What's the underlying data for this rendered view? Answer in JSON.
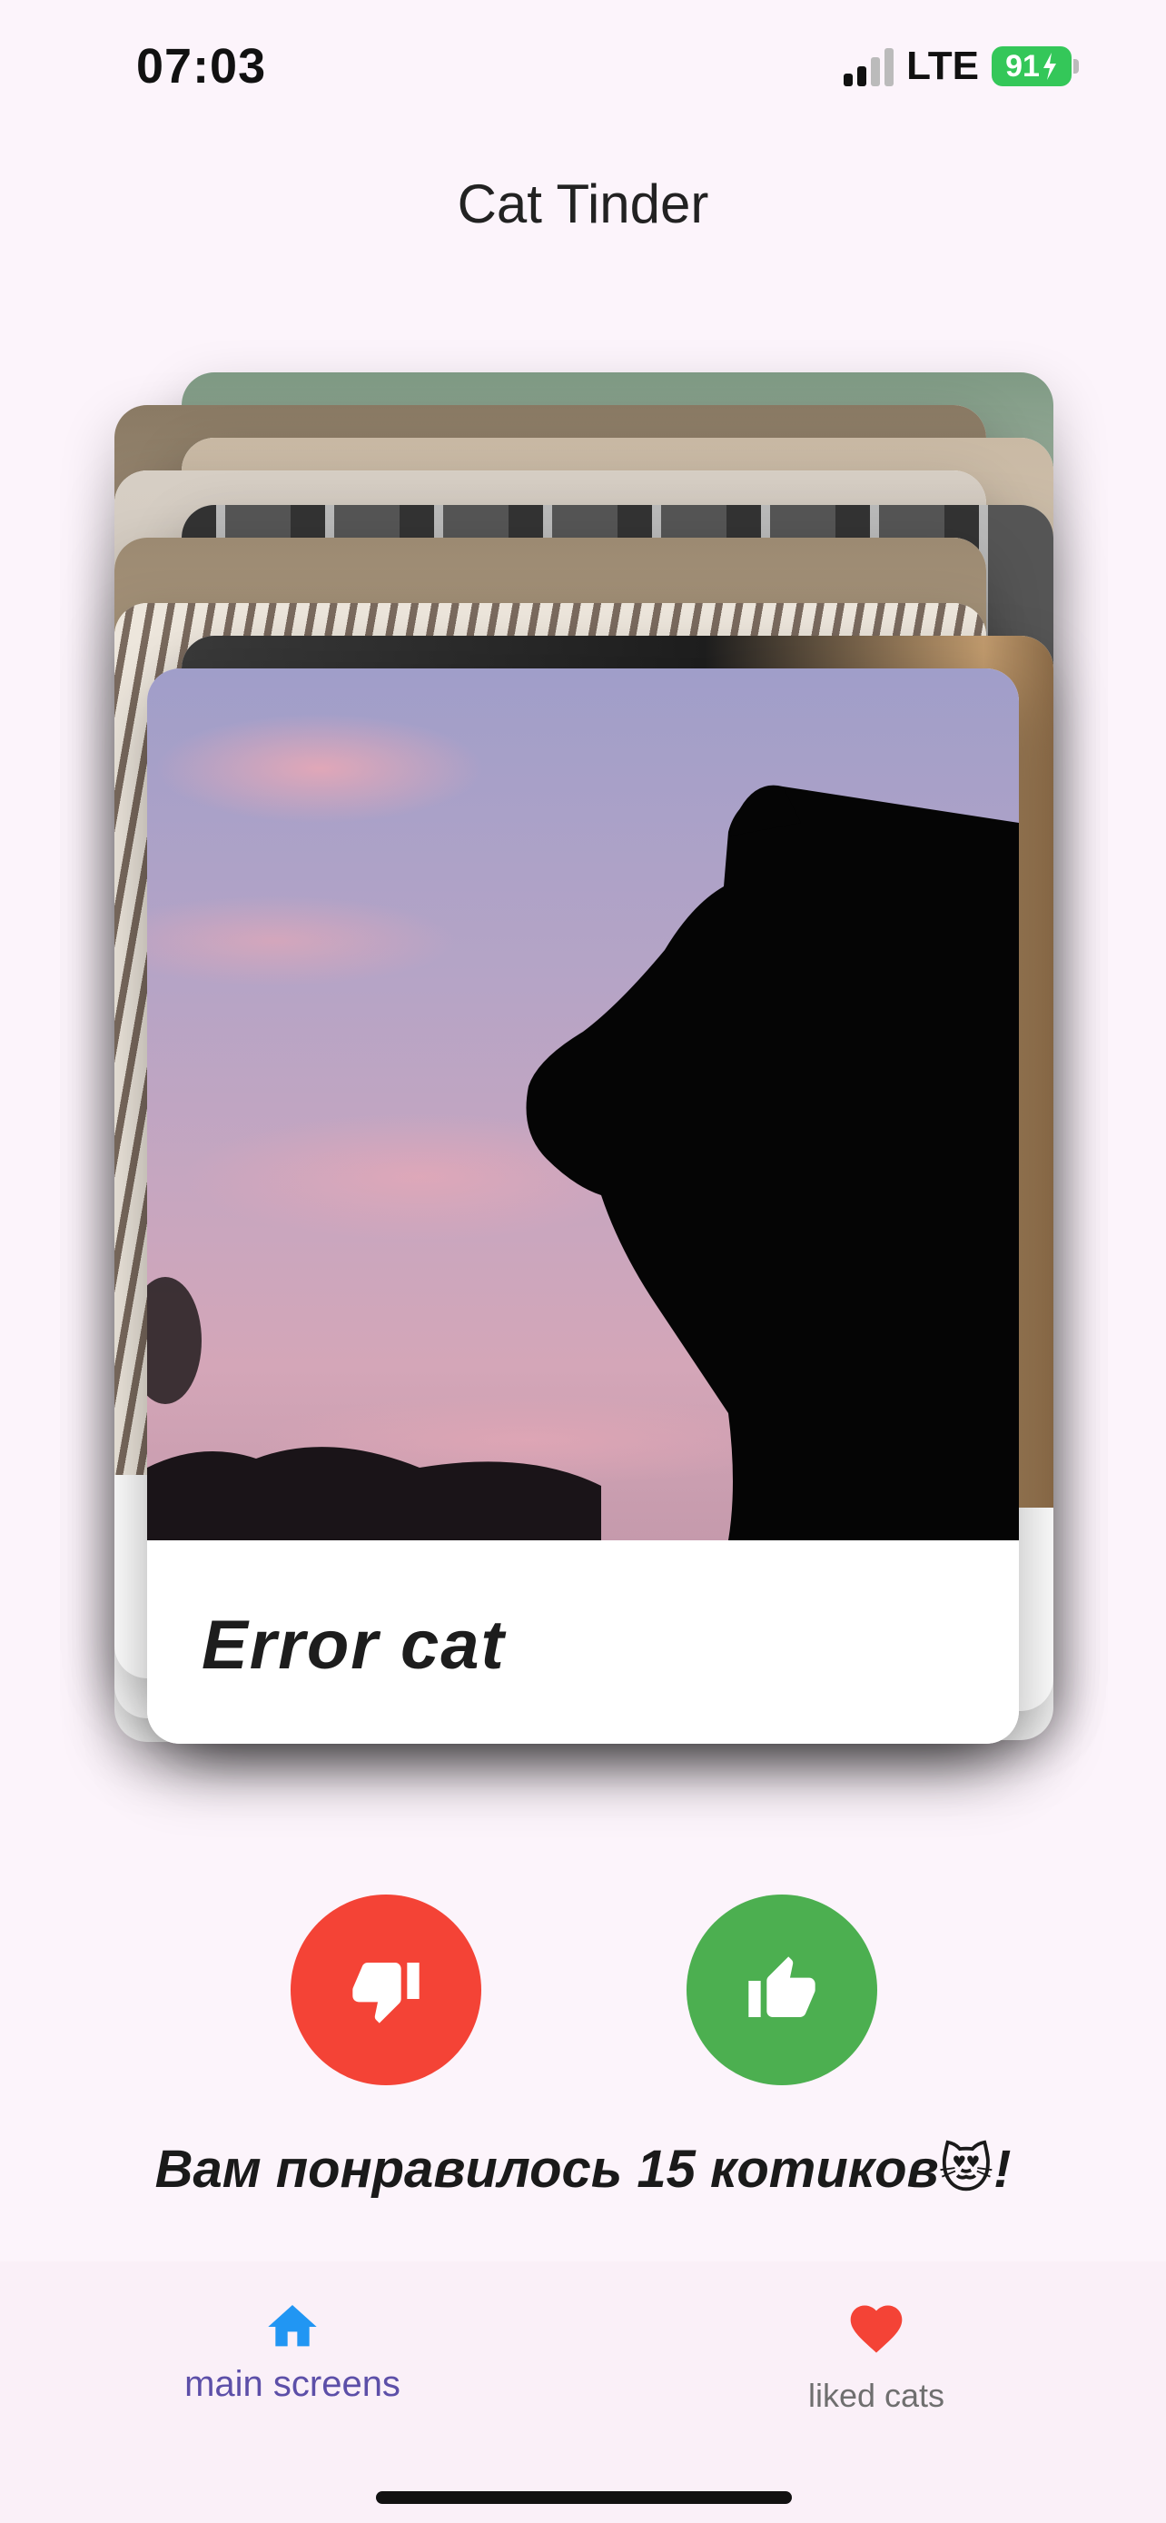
{
  "status_bar": {
    "time": "07:03",
    "network": "LTE",
    "battery": "91"
  },
  "app": {
    "title": "Cat Tinder"
  },
  "card": {
    "caption": "Error cat",
    "image_alt": "cat silhouette against pink sky"
  },
  "actions": {
    "dislike_icon": "thumb-down-icon",
    "like_icon": "thumb-up-icon",
    "dislike_color": "#f44336",
    "like_color": "#4caf50"
  },
  "liked_message": "Вам понравилось 15 котиков😻!",
  "nav": {
    "items": [
      {
        "label": "main screens",
        "icon": "home-icon",
        "color": "#2196f3"
      },
      {
        "label": "liked cats",
        "icon": "heart-icon",
        "color": "#f44336"
      }
    ]
  }
}
